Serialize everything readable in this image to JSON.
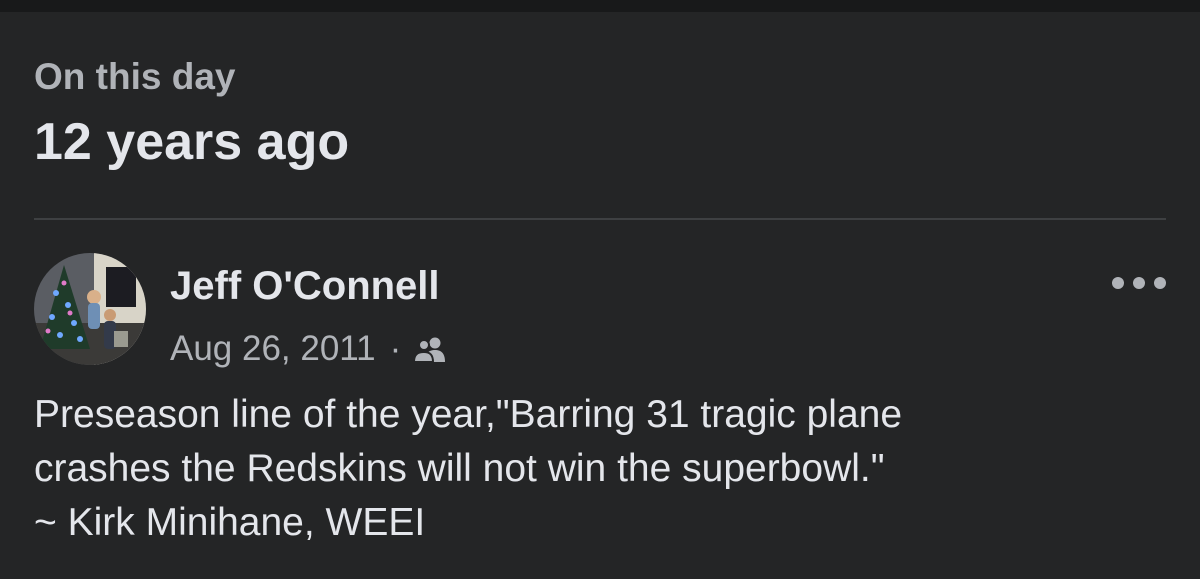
{
  "memory": {
    "label": "On this day",
    "title": "12 years ago"
  },
  "post": {
    "author_name": "Jeff O'Connell",
    "date": "Aug 26, 2011",
    "meta_separator": "·",
    "audience_icon": "friends-icon",
    "more_options_icon": "more-options-icon",
    "text_lines": [
      "Preseason line of the year,\"Barring 31 tragic plane",
      "crashes the Redskins will not win the superbowl.\"",
      "~ Kirk Minihane, WEEI"
    ]
  },
  "colors": {
    "background": "#242526",
    "top_strip": "#18191a",
    "primary_text": "#e4e6eb",
    "secondary_text": "#b0b3b8",
    "divider": "#3e4042"
  }
}
